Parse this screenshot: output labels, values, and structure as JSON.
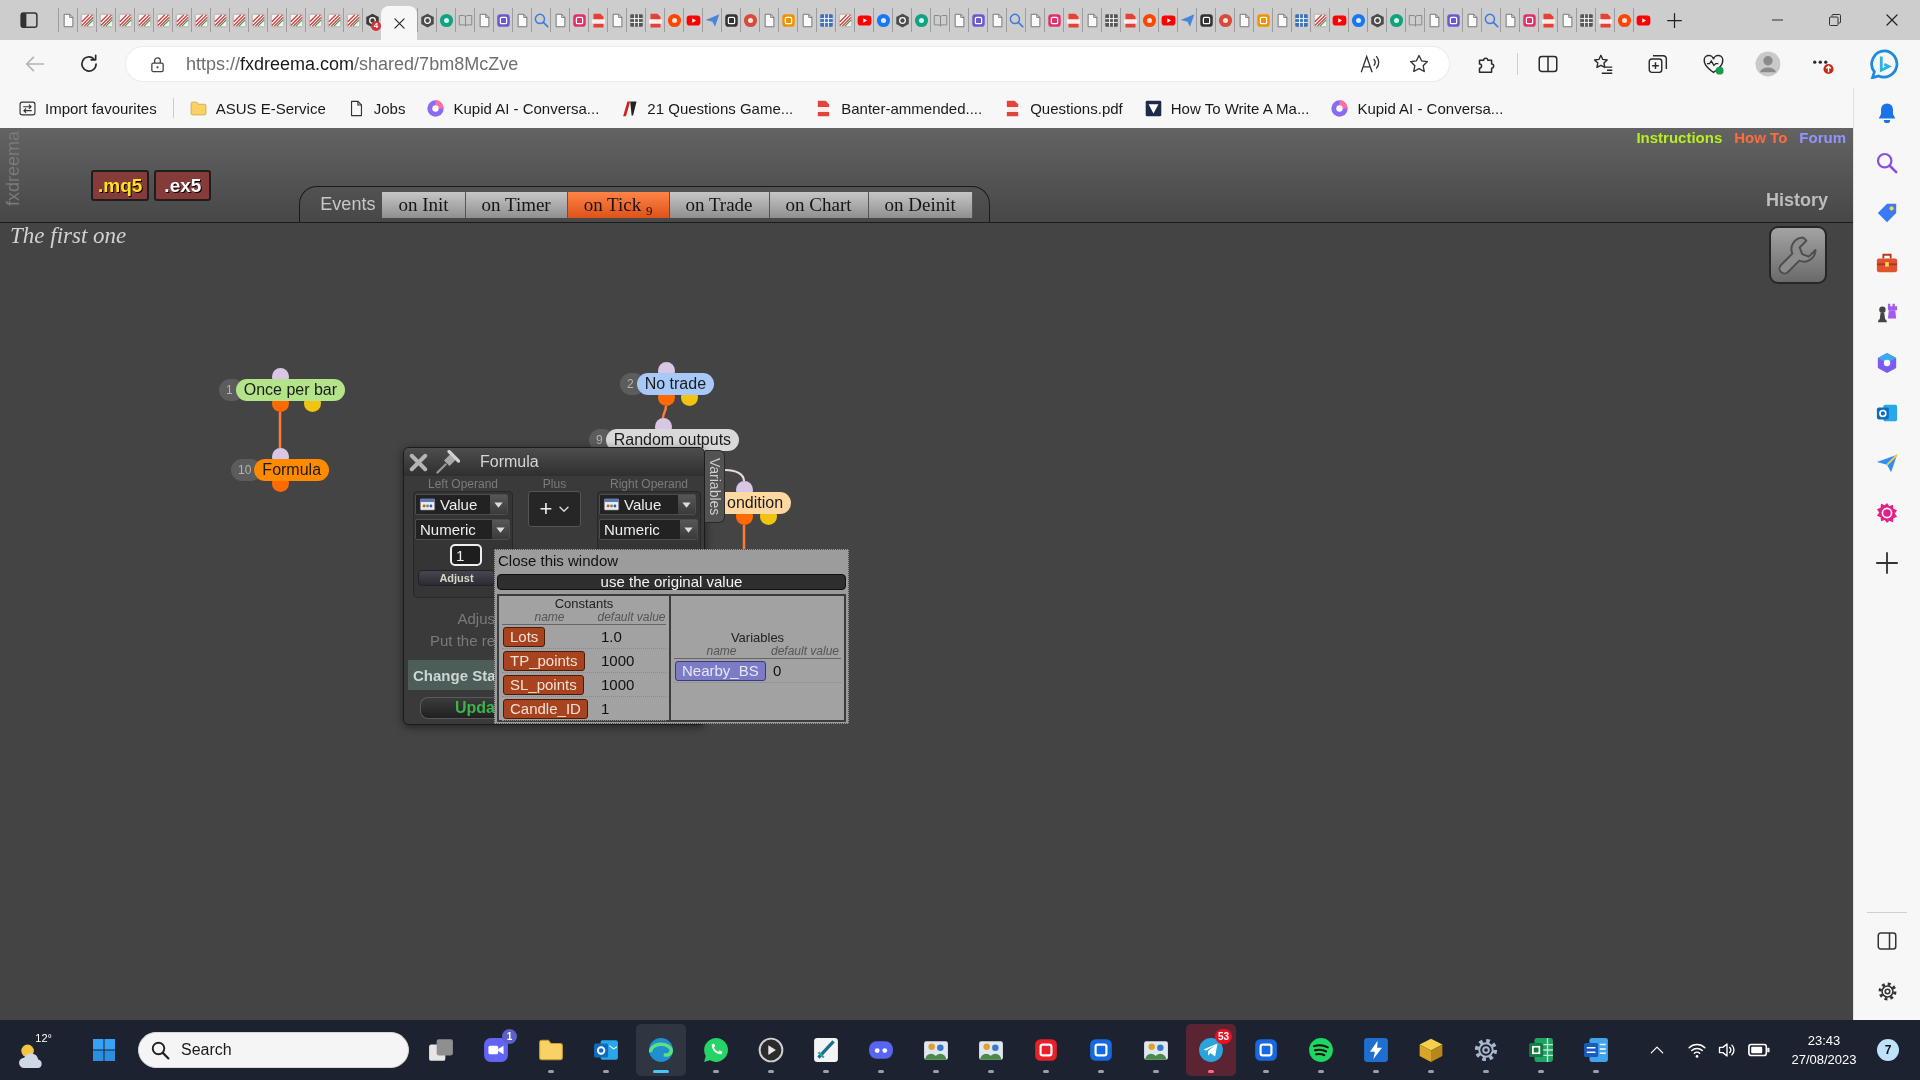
{
  "browser": {
    "tabs": [
      {
        "selected": false
      },
      {
        "selected": false
      },
      {
        "selected": false
      },
      {
        "selected": false
      },
      {
        "selected": false
      },
      {
        "selected": false
      },
      {
        "selected": false
      },
      {
        "selected": false
      },
      {
        "selected": false
      },
      {
        "selected": false
      },
      {
        "selected": false
      },
      {
        "selected": false
      },
      {
        "selected": false
      },
      {
        "selected": false
      },
      {
        "selected": false
      },
      {
        "selected": false
      },
      {
        "selected": false,
        "badge": "4"
      },
      {
        "selected": true
      },
      {
        "selected": false
      },
      {
        "selected": false
      },
      {
        "selected": false
      },
      {
        "selected": false
      },
      {
        "selected": false
      },
      {
        "selected": false
      },
      {
        "selected": false
      },
      {
        "selected": false
      },
      {
        "selected": false
      },
      {
        "selected": false
      },
      {
        "selected": false
      },
      {
        "selected": false
      },
      {
        "selected": false
      },
      {
        "selected": false
      },
      {
        "selected": false
      },
      {
        "selected": false
      },
      {
        "selected": false
      },
      {
        "selected": false
      },
      {
        "selected": false
      },
      {
        "selected": false
      },
      {
        "selected": false
      },
      {
        "selected": false
      },
      {
        "selected": false
      },
      {
        "selected": false
      },
      {
        "selected": false
      },
      {
        "selected": false
      },
      {
        "selected": false
      },
      {
        "selected": false
      },
      {
        "selected": false
      },
      {
        "selected": false
      },
      {
        "selected": false
      },
      {
        "selected": false
      },
      {
        "selected": false
      },
      {
        "selected": false
      },
      {
        "selected": false
      },
      {
        "selected": false
      },
      {
        "selected": false
      },
      {
        "selected": false
      },
      {
        "selected": false
      },
      {
        "selected": false
      },
      {
        "selected": false
      },
      {
        "selected": false
      },
      {
        "selected": false
      },
      {
        "selected": false
      },
      {
        "selected": false
      },
      {
        "selected": false
      },
      {
        "selected": false
      },
      {
        "selected": false
      },
      {
        "selected": false
      },
      {
        "selected": false
      },
      {
        "selected": false
      },
      {
        "selected": false
      },
      {
        "selected": false
      },
      {
        "selected": false
      },
      {
        "selected": false
      },
      {
        "selected": false
      },
      {
        "selected": false
      },
      {
        "selected": false
      },
      {
        "selected": false
      },
      {
        "selected": false
      },
      {
        "selected": false
      },
      {
        "selected": false
      },
      {
        "selected": false
      },
      {
        "selected": false
      },
      {
        "selected": false
      }
    ],
    "address_bar": {
      "scheme": "https://",
      "host": "fxdreema.com",
      "path": "/shared/7bm8McZve"
    },
    "bookmarks": [
      {
        "label": "Import favourites"
      },
      {
        "label": "ASUS E-Service"
      },
      {
        "label": "Jobs"
      },
      {
        "label": "Kupid AI - Conversa..."
      },
      {
        "label": "21 Questions Game..."
      },
      {
        "label": "Banter-ammended...."
      },
      {
        "label": "Questions.pdf"
      },
      {
        "label": "How To Write A Ma..."
      },
      {
        "label": "Kupid AI - Conversa..."
      }
    ]
  },
  "fxdreema": {
    "logo": "fxdreema",
    "exports": [
      {
        "label": ".mq5",
        "color": "#ffe31a"
      },
      {
        "label": ".ex5",
        "color": "#ffffff"
      }
    ],
    "events": {
      "label": "Events",
      "tabs": [
        {
          "label": "on Init",
          "selected": false
        },
        {
          "label": "on Timer",
          "selected": false
        },
        {
          "label": "on Tick",
          "count": "9",
          "selected": true
        },
        {
          "label": "on Trade",
          "selected": false
        },
        {
          "label": "on Chart",
          "selected": false
        },
        {
          "label": "on Deinit",
          "selected": false
        }
      ]
    },
    "links": [
      {
        "label": "Instructions",
        "color": "#b7f01e"
      },
      {
        "label": "How To",
        "color": "#ff6b3d"
      },
      {
        "label": "Forum",
        "color": "#9393ff"
      }
    ],
    "history": "History",
    "project_title": "The first one",
    "blocks": [
      {
        "number": "1",
        "label": "Once per bar",
        "color": "#b4e48a"
      },
      {
        "number": "10",
        "label": "Formula",
        "color": "#ff8a00"
      },
      {
        "number": "2",
        "label": "No trade",
        "color": "#a8c8f8"
      },
      {
        "number": "9",
        "label": "Random outputs",
        "color": "#d9d9d9"
      },
      {
        "label": "ondition",
        "color": "#ffd8a0"
      }
    ],
    "formula_window": {
      "title": "Formula",
      "side_tab": "Variables",
      "left_operand": {
        "label": "Left Operand",
        "source": "Value",
        "type": "Numeric",
        "value": "1",
        "adjust": "Adjust"
      },
      "operator": {
        "label": "Plus",
        "symbol": "+"
      },
      "right_operand": {
        "label": "Right Operand",
        "source": "Value",
        "type": "Numeric"
      },
      "notes": [
        "Adjus",
        "Put the re"
      ],
      "buttons": [
        {
          "label": "Change Sta",
          "kind": "state"
        },
        {
          "label": "Upda",
          "kind": "update"
        }
      ]
    },
    "value_picker": {
      "close": "Close this window",
      "reset": "use the original value",
      "constants": {
        "title": "Constants",
        "columns": [
          "name",
          "default value"
        ],
        "rows": [
          {
            "name": "Lots",
            "value": "1.0"
          },
          {
            "name": "TP_points",
            "value": "1000"
          },
          {
            "name": "SL_points",
            "value": "1000"
          },
          {
            "name": "Candle_ID",
            "value": "1"
          }
        ]
      },
      "variables": {
        "title": "Variables",
        "columns": [
          "name",
          "default value"
        ],
        "rows": [
          {
            "name": "Nearby_BS",
            "value": "0"
          }
        ]
      }
    }
  },
  "taskbar": {
    "weather": {
      "temperature": "12°"
    },
    "search": {
      "label": "Search"
    },
    "apps": [
      {
        "running": false,
        "selected": false,
        "attention": false
      },
      {
        "running": false,
        "selected": false,
        "attention": false,
        "badge": {
          "text": "1",
          "color": "#5b5fc7"
        }
      },
      {
        "running": true,
        "selected": false,
        "attention": false
      },
      {
        "running": true,
        "selected": false,
        "attention": false
      },
      {
        "running": true,
        "selected": true,
        "attention": false
      },
      {
        "running": true,
        "selected": false,
        "attention": false
      },
      {
        "running": true,
        "selected": false,
        "attention": false
      },
      {
        "running": true,
        "selected": false,
        "attention": false
      },
      {
        "running": true,
        "selected": false,
        "attention": false
      },
      {
        "running": true,
        "selected": false,
        "attention": false
      },
      {
        "running": true,
        "selected": false,
        "attention": false
      },
      {
        "running": true,
        "selected": false,
        "attention": false
      },
      {
        "running": true,
        "selected": false,
        "attention": false
      },
      {
        "running": true,
        "selected": false,
        "attention": false
      },
      {
        "running": true,
        "selected": false,
        "attention": true,
        "badge": {
          "text": "53",
          "color": "#e81123"
        }
      },
      {
        "running": true,
        "selected": false,
        "attention": false
      },
      {
        "running": true,
        "selected": false,
        "attention": false
      },
      {
        "running": true,
        "selected": false,
        "attention": false
      },
      {
        "running": true,
        "selected": false,
        "attention": false
      },
      {
        "running": true,
        "selected": false,
        "attention": false
      },
      {
        "running": true,
        "selected": false,
        "attention": false
      },
      {
        "running": true,
        "selected": false,
        "attention": false
      }
    ],
    "clock": {
      "time": "23:43",
      "date": "27/08/2023"
    },
    "notifications": "7"
  }
}
